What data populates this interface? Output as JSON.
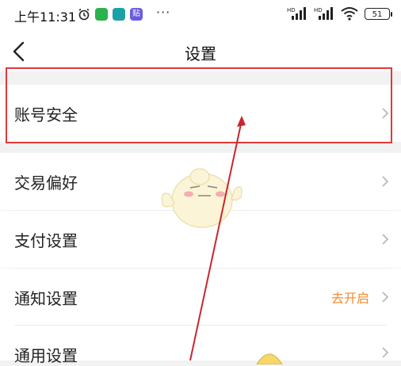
{
  "status_bar": {
    "time": "上午11:31",
    "battery": "51",
    "signal1": "HD",
    "signal2": "HD",
    "colors": {
      "wechat": "#2bb24c",
      "app2": "#1aa1a6",
      "app3": "#6a5be0"
    },
    "app3_label": "贴"
  },
  "nav": {
    "title": "设置",
    "back_icon": "chevron-left-icon"
  },
  "settings": {
    "account_security": "账号安全",
    "trade_pref": "交易偏好",
    "payment": "支付设置",
    "notification": "通知设置",
    "notification_hint": "去开启",
    "general": "通用设置"
  },
  "annotation": {
    "box_color": "#e03a3a",
    "arrow_color": "#c8262e"
  },
  "accent": "#f08c2e"
}
